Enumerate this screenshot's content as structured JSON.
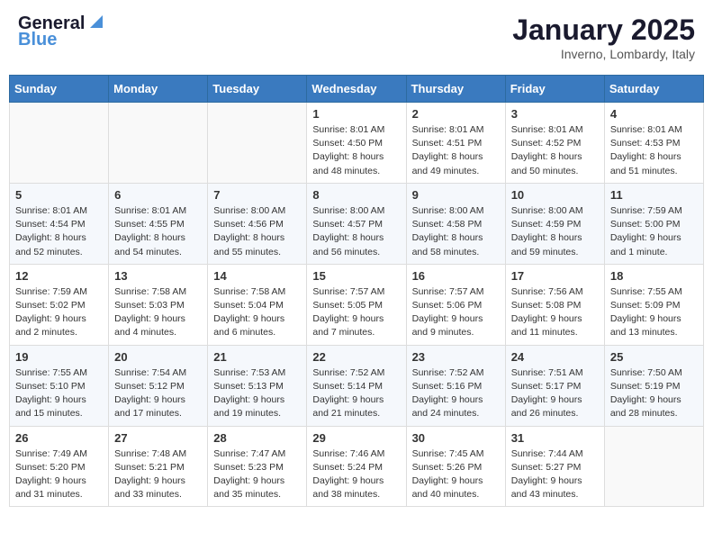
{
  "header": {
    "logo_line1": "General",
    "logo_line2": "Blue",
    "month_title": "January 2025",
    "location": "Inverno, Lombardy, Italy"
  },
  "days_of_week": [
    "Sunday",
    "Monday",
    "Tuesday",
    "Wednesday",
    "Thursday",
    "Friday",
    "Saturday"
  ],
  "weeks": [
    [
      {
        "day": "",
        "info": ""
      },
      {
        "day": "",
        "info": ""
      },
      {
        "day": "",
        "info": ""
      },
      {
        "day": "1",
        "info": "Sunrise: 8:01 AM\nSunset: 4:50 PM\nDaylight: 8 hours\nand 48 minutes."
      },
      {
        "day": "2",
        "info": "Sunrise: 8:01 AM\nSunset: 4:51 PM\nDaylight: 8 hours\nand 49 minutes."
      },
      {
        "day": "3",
        "info": "Sunrise: 8:01 AM\nSunset: 4:52 PM\nDaylight: 8 hours\nand 50 minutes."
      },
      {
        "day": "4",
        "info": "Sunrise: 8:01 AM\nSunset: 4:53 PM\nDaylight: 8 hours\nand 51 minutes."
      }
    ],
    [
      {
        "day": "5",
        "info": "Sunrise: 8:01 AM\nSunset: 4:54 PM\nDaylight: 8 hours\nand 52 minutes."
      },
      {
        "day": "6",
        "info": "Sunrise: 8:01 AM\nSunset: 4:55 PM\nDaylight: 8 hours\nand 54 minutes."
      },
      {
        "day": "7",
        "info": "Sunrise: 8:00 AM\nSunset: 4:56 PM\nDaylight: 8 hours\nand 55 minutes."
      },
      {
        "day": "8",
        "info": "Sunrise: 8:00 AM\nSunset: 4:57 PM\nDaylight: 8 hours\nand 56 minutes."
      },
      {
        "day": "9",
        "info": "Sunrise: 8:00 AM\nSunset: 4:58 PM\nDaylight: 8 hours\nand 58 minutes."
      },
      {
        "day": "10",
        "info": "Sunrise: 8:00 AM\nSunset: 4:59 PM\nDaylight: 8 hours\nand 59 minutes."
      },
      {
        "day": "11",
        "info": "Sunrise: 7:59 AM\nSunset: 5:00 PM\nDaylight: 9 hours\nand 1 minute."
      }
    ],
    [
      {
        "day": "12",
        "info": "Sunrise: 7:59 AM\nSunset: 5:02 PM\nDaylight: 9 hours\nand 2 minutes."
      },
      {
        "day": "13",
        "info": "Sunrise: 7:58 AM\nSunset: 5:03 PM\nDaylight: 9 hours\nand 4 minutes."
      },
      {
        "day": "14",
        "info": "Sunrise: 7:58 AM\nSunset: 5:04 PM\nDaylight: 9 hours\nand 6 minutes."
      },
      {
        "day": "15",
        "info": "Sunrise: 7:57 AM\nSunset: 5:05 PM\nDaylight: 9 hours\nand 7 minutes."
      },
      {
        "day": "16",
        "info": "Sunrise: 7:57 AM\nSunset: 5:06 PM\nDaylight: 9 hours\nand 9 minutes."
      },
      {
        "day": "17",
        "info": "Sunrise: 7:56 AM\nSunset: 5:08 PM\nDaylight: 9 hours\nand 11 minutes."
      },
      {
        "day": "18",
        "info": "Sunrise: 7:55 AM\nSunset: 5:09 PM\nDaylight: 9 hours\nand 13 minutes."
      }
    ],
    [
      {
        "day": "19",
        "info": "Sunrise: 7:55 AM\nSunset: 5:10 PM\nDaylight: 9 hours\nand 15 minutes."
      },
      {
        "day": "20",
        "info": "Sunrise: 7:54 AM\nSunset: 5:12 PM\nDaylight: 9 hours\nand 17 minutes."
      },
      {
        "day": "21",
        "info": "Sunrise: 7:53 AM\nSunset: 5:13 PM\nDaylight: 9 hours\nand 19 minutes."
      },
      {
        "day": "22",
        "info": "Sunrise: 7:52 AM\nSunset: 5:14 PM\nDaylight: 9 hours\nand 21 minutes."
      },
      {
        "day": "23",
        "info": "Sunrise: 7:52 AM\nSunset: 5:16 PM\nDaylight: 9 hours\nand 24 minutes."
      },
      {
        "day": "24",
        "info": "Sunrise: 7:51 AM\nSunset: 5:17 PM\nDaylight: 9 hours\nand 26 minutes."
      },
      {
        "day": "25",
        "info": "Sunrise: 7:50 AM\nSunset: 5:19 PM\nDaylight: 9 hours\nand 28 minutes."
      }
    ],
    [
      {
        "day": "26",
        "info": "Sunrise: 7:49 AM\nSunset: 5:20 PM\nDaylight: 9 hours\nand 31 minutes."
      },
      {
        "day": "27",
        "info": "Sunrise: 7:48 AM\nSunset: 5:21 PM\nDaylight: 9 hours\nand 33 minutes."
      },
      {
        "day": "28",
        "info": "Sunrise: 7:47 AM\nSunset: 5:23 PM\nDaylight: 9 hours\nand 35 minutes."
      },
      {
        "day": "29",
        "info": "Sunrise: 7:46 AM\nSunset: 5:24 PM\nDaylight: 9 hours\nand 38 minutes."
      },
      {
        "day": "30",
        "info": "Sunrise: 7:45 AM\nSunset: 5:26 PM\nDaylight: 9 hours\nand 40 minutes."
      },
      {
        "day": "31",
        "info": "Sunrise: 7:44 AM\nSunset: 5:27 PM\nDaylight: 9 hours\nand 43 minutes."
      },
      {
        "day": "",
        "info": ""
      }
    ]
  ]
}
